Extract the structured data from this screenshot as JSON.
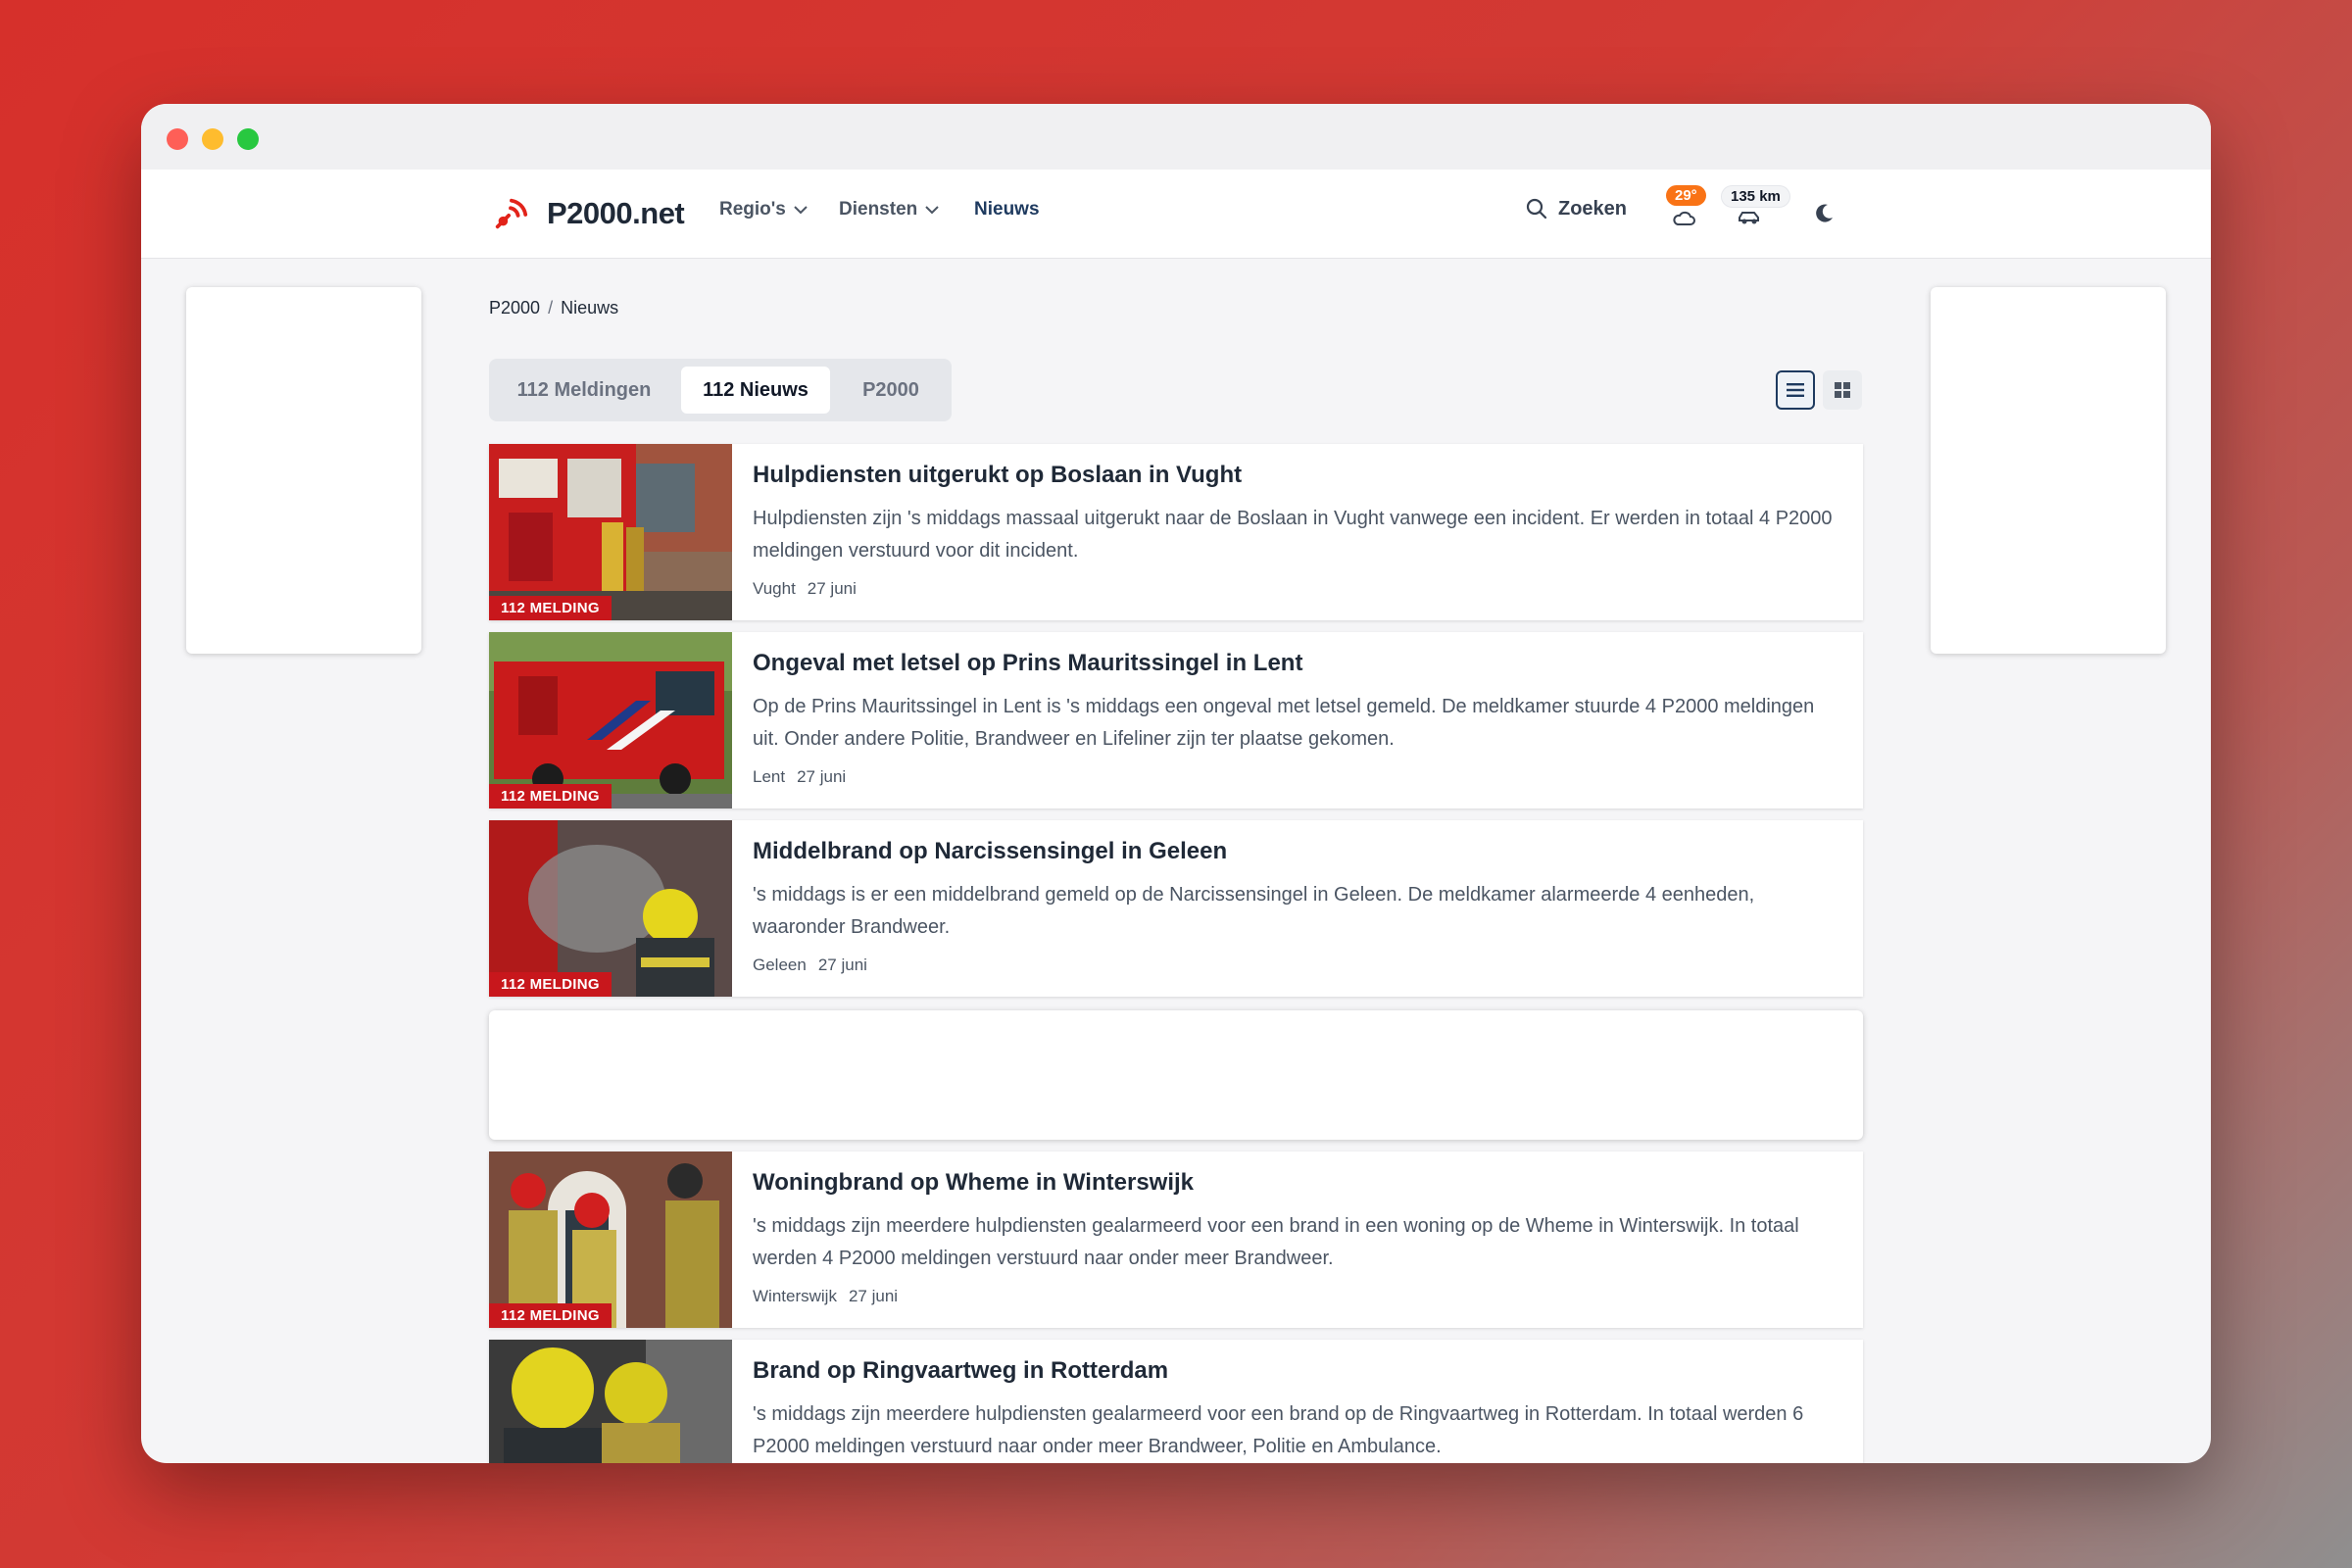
{
  "brand": {
    "name": "P2000.net"
  },
  "nav": {
    "items": [
      {
        "label": "Regio's"
      },
      {
        "label": "Diensten"
      },
      {
        "label": "Nieuws"
      }
    ],
    "search_label": "Zoeken",
    "weather": {
      "temperature": "29°"
    },
    "traffic": {
      "distance": "135 km"
    }
  },
  "breadcrumb": {
    "home": "P2000",
    "separator": "/",
    "current": "Nieuws"
  },
  "tabs": [
    {
      "label": "112 Meldingen"
    },
    {
      "label": "112 Nieuws"
    },
    {
      "label": "P2000"
    }
  ],
  "articles": [
    {
      "badge": "112 MELDING",
      "title": "Hulpdiensten uitgerukt op Boslaan in Vught",
      "text": "Hulpdiensten zijn 's middags massaal uitgerukt naar de Boslaan in Vught vanwege een incident. Er werden in totaal 4 P2000 meldingen verstuurd voor dit incident.",
      "place": "Vught",
      "date": "27 juni"
    },
    {
      "badge": "112 MELDING",
      "title": "Ongeval met letsel op Prins Mauritssingel in Lent",
      "text": "Op de Prins Mauritssingel in Lent is 's middags een ongeval met letsel gemeld. De meldkamer stuurde 4 P2000 meldingen uit. Onder andere Politie, Brandweer en Lifeliner zijn ter plaatse gekomen.",
      "place": "Lent",
      "date": "27 juni"
    },
    {
      "badge": "112 MELDING",
      "title": "Middelbrand op Narcissensingel in Geleen",
      "text": "'s middags is er een middelbrand gemeld op de Narcissensingel in Geleen. De meldkamer alarmeerde 4 eenheden, waaronder Brandweer.",
      "place": "Geleen",
      "date": "27 juni"
    },
    {
      "badge": "112 MELDING",
      "title": "Woningbrand op Wheme in Winterswijk",
      "text": "'s middags zijn meerdere hulpdiensten gealarmeerd voor een brand in een woning op de Wheme in Winterswijk. In totaal werden 4 P2000 meldingen verstuurd naar onder meer Brandweer.",
      "place": "Winterswijk",
      "date": "27 juni"
    },
    {
      "title": "Brand op Ringvaartweg in Rotterdam",
      "text": "'s middags zijn meerdere hulpdiensten gealarmeerd voor een brand op de Ringvaartweg in Rotterdam. In totaal werden 6 P2000 meldingen verstuurd naar onder meer Brandweer, Politie en Ambulance."
    }
  ]
}
